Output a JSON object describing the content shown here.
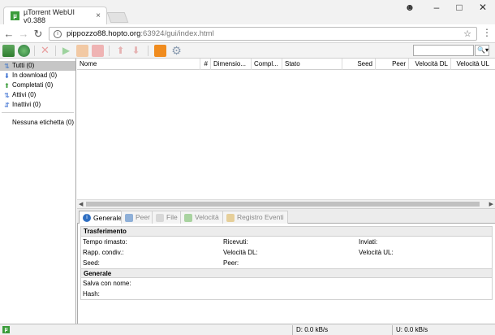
{
  "browser": {
    "tab_title": "µTorrent WebUI v0.388",
    "tab_close": "×",
    "favicon_letter": "µ",
    "url_host": "pippozzo88.hopto.org",
    "url_rest": ":63924/gui/index.html"
  },
  "window_controls": {
    "account": "☻",
    "minimize": "–",
    "maximize": "□",
    "close": "✕"
  },
  "toolbar": {
    "buttons": [
      "add-torrent-icon",
      "add-url-icon",
      "remove-icon",
      "start-icon",
      "pause-icon",
      "stop-icon",
      "move-up-icon",
      "move-down-icon",
      "rss-icon",
      "settings-icon"
    ],
    "search_placeholder": ""
  },
  "sidebar": {
    "categories": [
      {
        "label": "Tutti (0)",
        "icon": "all-icon",
        "color": "#4a7cc6",
        "selected": true
      },
      {
        "label": "In download (0)",
        "icon": "download-icon",
        "color": "#3b6fd1"
      },
      {
        "label": "Completati (0)",
        "icon": "completed-icon",
        "color": "#3a9c3a"
      },
      {
        "label": "Attivi (0)",
        "icon": "active-icon",
        "color": "#3b6fd1"
      },
      {
        "label": "Inattivi (0)",
        "icon": "inactive-icon",
        "color": "#3b6fd1"
      }
    ],
    "labels": [
      {
        "label": "Nessuna etichetta (0)"
      }
    ]
  },
  "torrent_list": {
    "columns": [
      "Nome",
      "#",
      "Dimensio...",
      "Compl...",
      "Stato",
      "Seed",
      "Peer",
      "Velocità DL",
      "Velocità UL"
    ],
    "rows": []
  },
  "detail_tabs": [
    {
      "label": "Generale",
      "icon": "info-icon",
      "active": true
    },
    {
      "label": "Peer",
      "icon": "peers-icon"
    },
    {
      "label": "File",
      "icon": "file-icon"
    },
    {
      "label": "Velocità",
      "icon": "speed-icon"
    },
    {
      "label": "Registro Eventi",
      "icon": "log-icon"
    }
  ],
  "details": {
    "transfer_title": "Trasferimento",
    "transfer_fields": [
      [
        "Tempo rimasto:",
        "Ricevuti:",
        "Inviati:"
      ],
      [
        "Rapp. condiv.:",
        "Velocità DL:",
        "Velocità UL:"
      ],
      [
        "Seed:",
        "Peer:",
        ""
      ]
    ],
    "general_title": "Generale",
    "general_fields": [
      "Salva con nome:",
      "Hash:"
    ]
  },
  "statusbar": {
    "download": "D: 0.0 kB/s",
    "upload": "U: 0.0 kB/s"
  }
}
